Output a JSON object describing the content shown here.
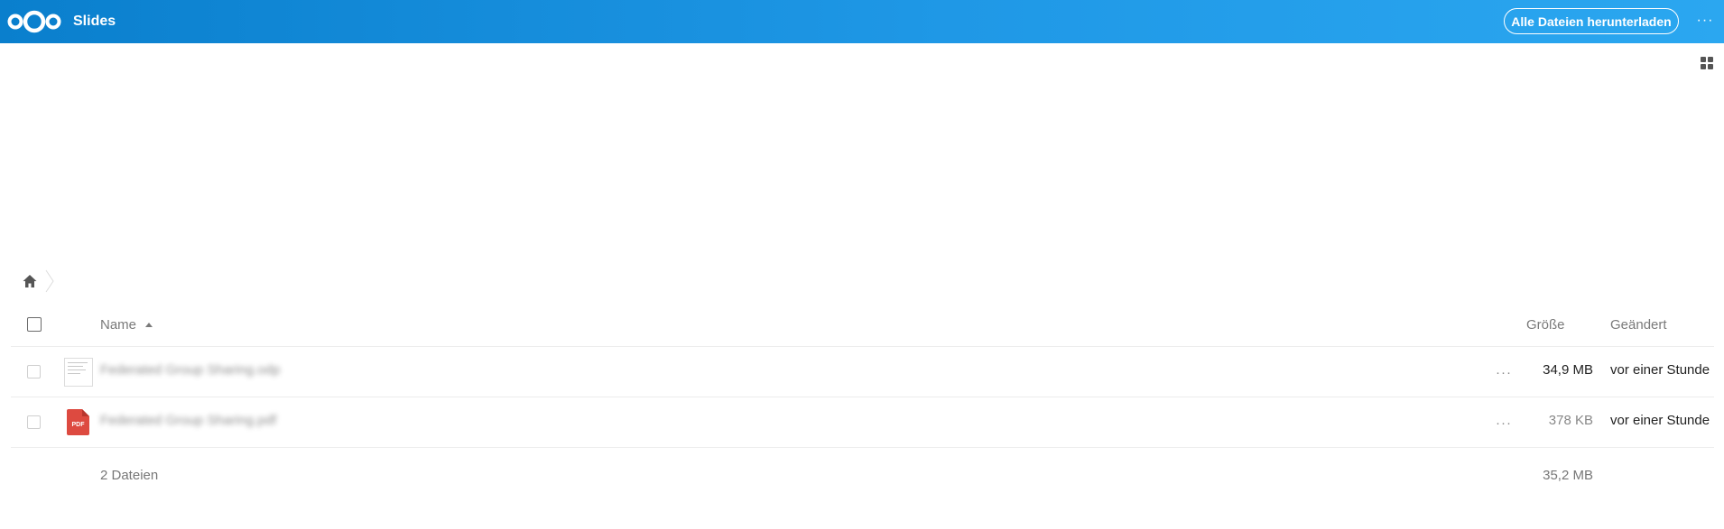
{
  "header": {
    "app_title": "Slides",
    "download_all_label": "Alle Dateien herunterladen",
    "more_label": "···",
    "accent_color": "#0a7fcd"
  },
  "toolbar": {
    "view_toggle_icon": "grid-view-icon"
  },
  "breadcrumb": {
    "home_icon": "home-icon"
  },
  "table": {
    "columns": {
      "name": "Name",
      "size": "Größe",
      "modified": "Geändert"
    },
    "sort": "name-ascending",
    "rows": [
      {
        "name": "Federated Group Sharing.odp",
        "icon": "document-thumbnail",
        "actions_label": "···",
        "size": "34,9 MB",
        "modified": "vor einer Stunde"
      },
      {
        "name": "Federated Group Sharing.pdf",
        "icon": "pdf-icon",
        "actions_label": "···",
        "size": "378 KB",
        "modified": "vor einer Stunde"
      }
    ],
    "summary": {
      "count": "2 Dateien",
      "total_size": "35,2 MB"
    }
  }
}
